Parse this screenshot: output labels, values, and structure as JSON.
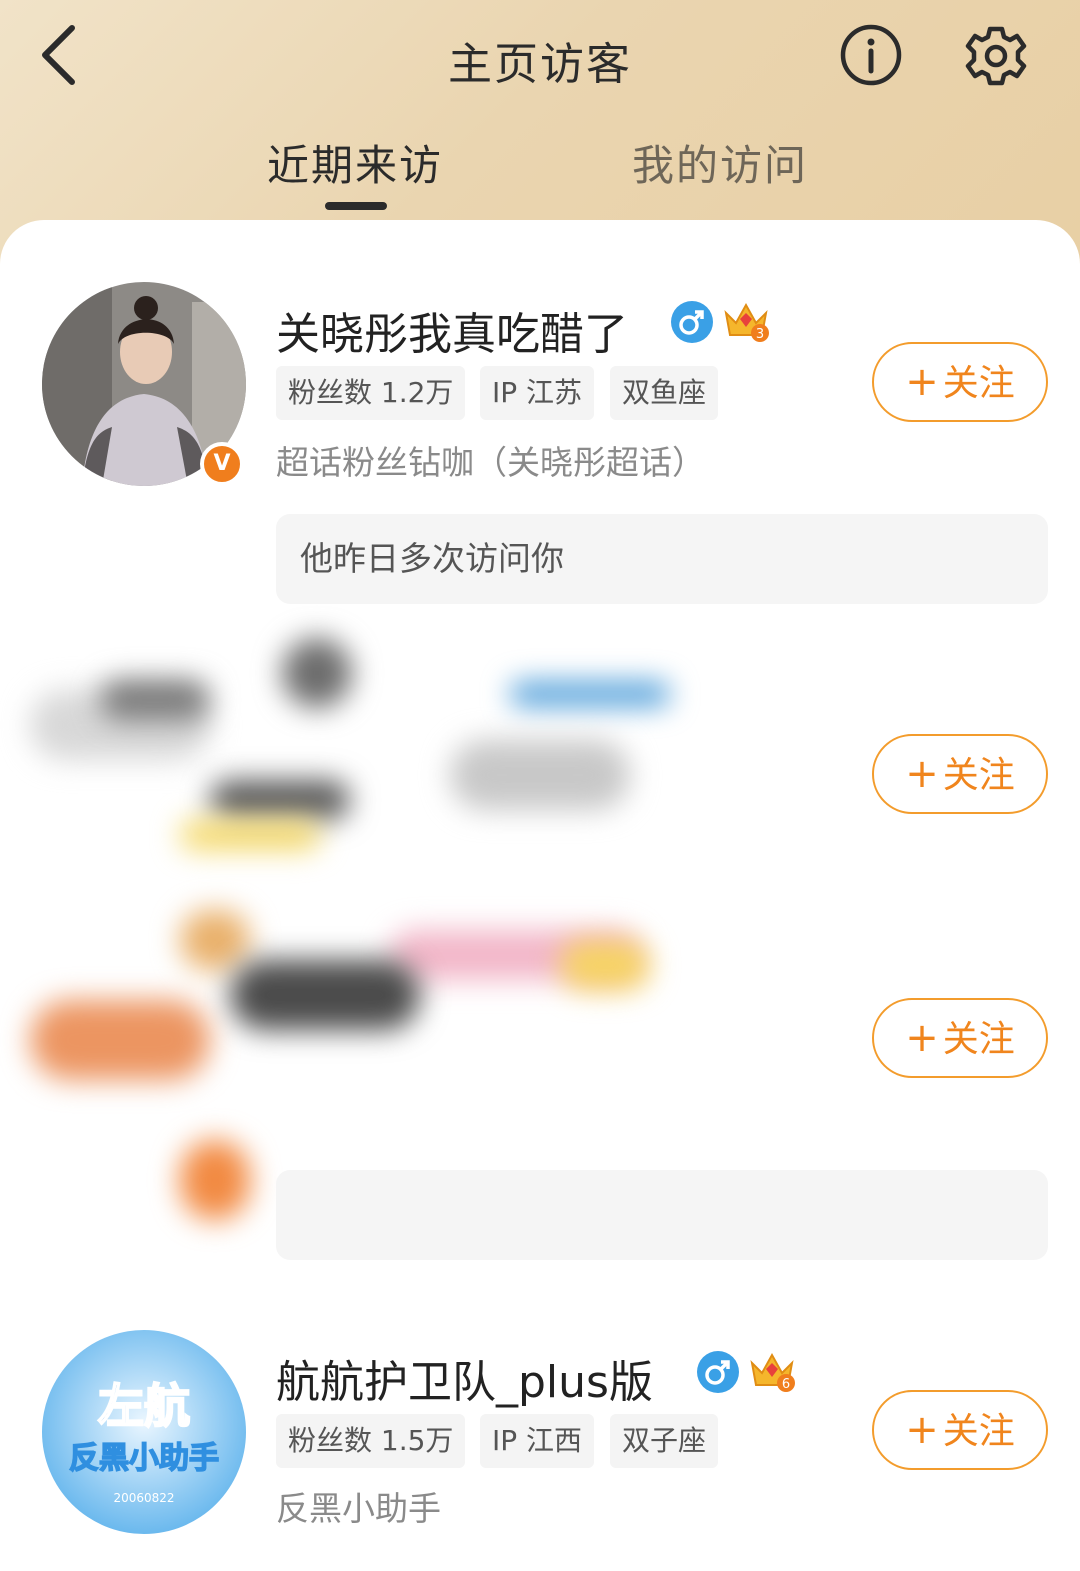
{
  "header": {
    "title": "主页访客",
    "tabs": [
      {
        "label": "近期来访",
        "active": true
      },
      {
        "label": "我的访问",
        "active": false
      }
    ]
  },
  "visitors": [
    {
      "name": "关晓彤我真吃醋了",
      "gender": "male",
      "level_badge": "3",
      "verified": true,
      "tags": [
        "粉丝数 1.2万",
        "IP 江苏",
        "双鱼座"
      ],
      "description": "超话粉丝钻咖（关晓彤超话）",
      "note": "他昨日多次访问你",
      "follow_label": "关注"
    },
    {
      "redacted": true,
      "follow_label": "关注"
    },
    {
      "redacted": true,
      "follow_label": "关注"
    },
    {
      "name": "航航护卫队_plus版",
      "gender": "male",
      "level_badge": "6",
      "tags": [
        "粉丝数 1.5万",
        "IP 江西",
        "双子座"
      ],
      "description": "反黑小助手",
      "follow_label": "关注",
      "avatar_text": {
        "line1": "左航",
        "line2": "反黑小助手",
        "line3": "20060822"
      }
    }
  ],
  "colors": {
    "accent": "#f0851d",
    "header_gradient": "#ead5b0",
    "badge_blue": "#3aa0e6"
  },
  "icons": [
    "back-icon",
    "info-icon",
    "settings-icon",
    "male-gender-icon",
    "crown-icon",
    "verified-icon"
  ]
}
